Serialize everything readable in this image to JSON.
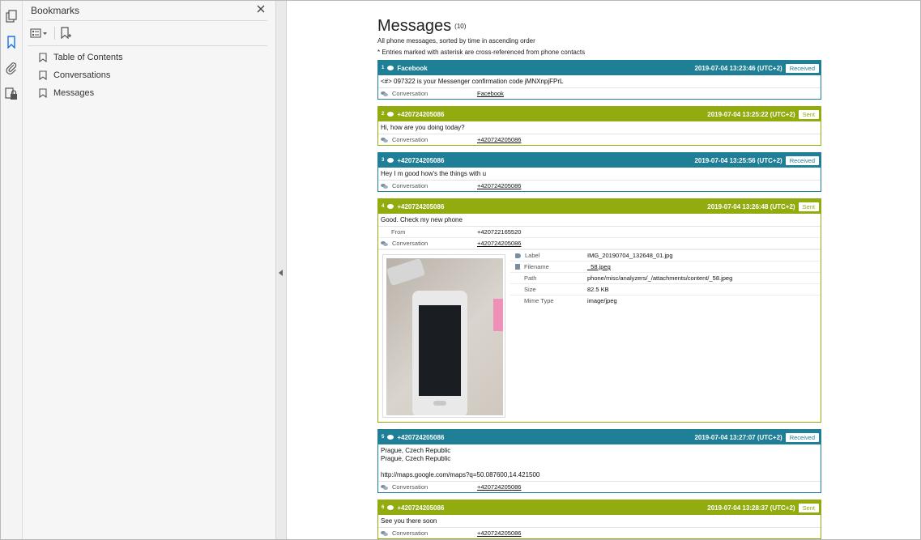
{
  "sidebar_tools": {
    "page_thumbnails_icon": "pages-icon",
    "bookmarks_icon": "bookmark-icon",
    "attachments_icon": "paperclip-icon",
    "layers_icon": "layers-lock-icon"
  },
  "bookmarks": {
    "title": "Bookmarks",
    "items": [
      {
        "label": "Table of Contents"
      },
      {
        "label": "Conversations"
      },
      {
        "label": "Messages"
      }
    ]
  },
  "document": {
    "title": "Messages",
    "count": "(10)",
    "subtitle": "All phone messages, sorted by time in ascending order",
    "note": "* Entries marked with asterisk are cross-referenced from phone contacts",
    "conversation_label": "Conversation",
    "from_label": "From",
    "messages": [
      {
        "index": "1",
        "sender": "Facebook",
        "time": "2019-07-04 13:23:46 (UTC+2)",
        "status": "Received",
        "body": "<#> 097322 is your Messenger confirmation code jMNXnpjFPrL",
        "conversation": "Facebook"
      },
      {
        "index": "2",
        "sender": "+420724205086",
        "time": "2019-07-04 13:25:22 (UTC+2)",
        "status": "Sent",
        "body": "Hi, how are you doing today?",
        "conversation": "+420724205086"
      },
      {
        "index": "3",
        "sender": "+420724205086",
        "time": "2019-07-04 13:25:56 (UTC+2)",
        "status": "Received",
        "body": "Hey I m good how's the things with u",
        "conversation": "+420724205086"
      },
      {
        "index": "4",
        "sender": "+420724205086",
        "time": "2019-07-04 13:26:48 (UTC+2)",
        "status": "Sent",
        "body": "Good. Check my new phone",
        "from": "+420722165520",
        "conversation": "+420724205086",
        "attachment": {
          "label_key": "Label",
          "label": "IMG_20190704_132648_01.jpg",
          "filename_key": "Filename",
          "filename": "_58.jpeg",
          "path_key": "Path",
          "path": "phone/misc/analyzers/_/attachments/content/_58.jpeg",
          "size_key": "Size",
          "size": "82.5 KB",
          "mime_key": "Mime Type",
          "mime": "image/jpeg"
        }
      },
      {
        "index": "5",
        "sender": "+420724205086",
        "time": "2019-07-04 13:27:07 (UTC+2)",
        "status": "Received",
        "body_lines": [
          "Prague, Czech Republic",
          "Prague, Czech Republic",
          "",
          "http://maps.google.com/maps?q=50.087600,14.421500"
        ],
        "conversation": "+420724205086"
      },
      {
        "index": "6",
        "sender": "+420724205086",
        "time": "2019-07-04 13:28:37 (UTC+2)",
        "status": "Sent",
        "body": "See you there soon",
        "conversation": "+420724205086"
      }
    ]
  },
  "colors": {
    "received": "#1e7f97",
    "sent": "#92ac10"
  }
}
